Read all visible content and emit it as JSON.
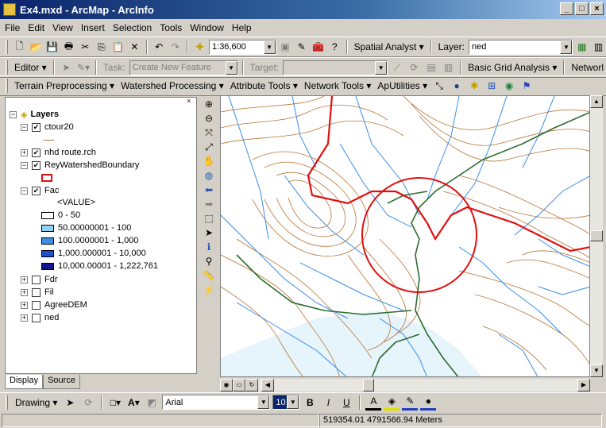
{
  "window": {
    "title": "Ex4.mxd - ArcMap - ArcInfo",
    "min": "_",
    "max": "□",
    "close": "×"
  },
  "menu": [
    "File",
    "Edit",
    "View",
    "Insert",
    "Selection",
    "Tools",
    "Window",
    "Help"
  ],
  "standard_toolbar": {
    "scale": "1:36,600",
    "spatial_analyst": "Spatial Analyst ▾",
    "layer_label": "Layer:",
    "layer_value": "ned"
  },
  "editor_toolbar": {
    "editor": "Editor ▾",
    "task_label": "Task:",
    "task_value": "Create New Feature",
    "target_label": "Target:",
    "basic_grid": "Basic Grid Analysis ▾",
    "network": "Networl"
  },
  "hydro_toolbar": [
    "Terrain Preprocessing ▾",
    "Watershed Processing ▾",
    "Attribute Tools ▾",
    "Network Tools ▾",
    "ApUtilities ▾"
  ],
  "toc": {
    "root": "Layers",
    "layers": [
      {
        "name": "ctour20",
        "checked": true,
        "expanded": true
      },
      {
        "name": "nhd route.rch",
        "checked": true,
        "expanded": false
      },
      {
        "name": "ReyWatershedBoundary",
        "checked": true,
        "expanded": true
      },
      {
        "name": "Fac",
        "checked": true,
        "expanded": true
      },
      {
        "name": "Fdr",
        "checked": false,
        "expanded": false
      },
      {
        "name": "Fil",
        "checked": false,
        "expanded": false
      },
      {
        "name": "AgreeDEM",
        "checked": false,
        "expanded": false
      },
      {
        "name": "ned",
        "checked": false,
        "expanded": false
      }
    ],
    "fac_field": "<VALUE>",
    "fac_classes": [
      {
        "label": "0 - 50",
        "color": "#ffffff"
      },
      {
        "label": "50.00000001 - 100",
        "color": "#8fd3f4"
      },
      {
        "label": "100.0000001 - 1,000",
        "color": "#3a8ee6"
      },
      {
        "label": "1,000.000001 - 10,000",
        "color": "#1f4fd0"
      },
      {
        "label": "10,000.00001 - 1,222,761",
        "color": "#14148c"
      }
    ]
  },
  "tabs": [
    "Display",
    "Source"
  ],
  "drawing_toolbar": {
    "drawing": "Drawing ▾",
    "font": "Arial",
    "size": "10",
    "bold": "B",
    "italic": "I",
    "underline": "U"
  },
  "status": {
    "coords": "519354.01  4791566.94 Meters"
  },
  "colors": {
    "contour": "#b87333",
    "stream": "#3a8ee6",
    "river": "#2e6b2e",
    "boundary": "#e01010"
  }
}
